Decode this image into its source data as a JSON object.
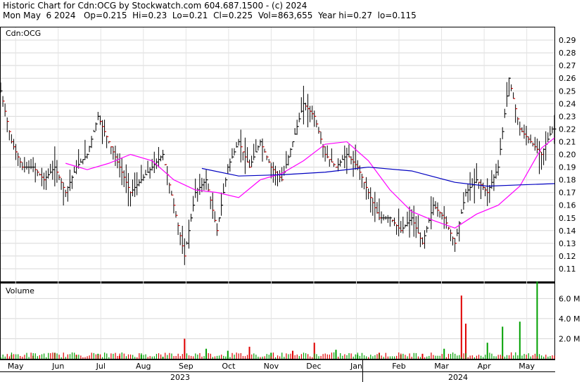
{
  "header": {
    "line1": "Historic Chart for Cdn:OCG by Stockwatch.com 604.687.1500 - (c) 2024",
    "line2": "Mon May  6 2024   Op=0.215  Hi=0.23  Lo=0.21  Cl=0.225  Vol=863,655  Year hi=0.27  lo=0.115"
  },
  "chart_data": [
    {
      "type": "ohlc",
      "title": "Cdn:OCG",
      "ylim": [
        0.1,
        0.3
      ],
      "yticks": [
        "0.11",
        "0.12",
        "0.13",
        "0.14",
        "0.15",
        "0.16",
        "0.17",
        "0.18",
        "0.19",
        "0.20",
        "0.21",
        "0.22",
        "0.23",
        "0.24",
        "0.25",
        "0.26",
        "0.27",
        "0.28",
        "0.29"
      ],
      "month_ticks": [
        "May",
        "Jun",
        "Jul",
        "Aug",
        "Sep",
        "Oct",
        "Nov",
        "Dec",
        "Jan",
        "Feb",
        "Mar",
        "Apr",
        "May"
      ],
      "year_labels": [
        "2023",
        "2024"
      ],
      "x_range": [
        0,
        256
      ],
      "series": [
        {
          "name": "",
          "kind": "price",
          "x": [
            0,
            5,
            10,
            15,
            20,
            25,
            30,
            35,
            40,
            45,
            50,
            55,
            60,
            65,
            70,
            75,
            80,
            85,
            90,
            95,
            100,
            105,
            110,
            115,
            120,
            125,
            130,
            135,
            140,
            145,
            150,
            155,
            160,
            165,
            170,
            175,
            180,
            185,
            190,
            195,
            200,
            205,
            210,
            215,
            220,
            225,
            230,
            235,
            240,
            245,
            250,
            255
          ],
          "values": [
            0.25,
            0.21,
            0.19,
            0.19,
            0.18,
            0.19,
            0.17,
            0.19,
            0.2,
            0.23,
            0.21,
            0.19,
            0.17,
            0.18,
            0.19,
            0.2,
            0.16,
            0.12,
            0.17,
            0.18,
            0.14,
            0.19,
            0.21,
            0.19,
            0.21,
            0.19,
            0.18,
            0.21,
            0.24,
            0.23,
            0.2,
            0.19,
            0.2,
            0.19,
            0.17,
            0.15,
            0.15,
            0.14,
            0.15,
            0.13,
            0.16,
            0.15,
            0.13,
            0.17,
            0.18,
            0.17,
            0.19,
            0.26,
            0.22,
            0.21,
            0.2,
            0.22
          ]
        },
        {
          "name": "",
          "kind": "moving-average-short",
          "color": "#ff00ff",
          "x": [
            30,
            40,
            50,
            60,
            70,
            80,
            90,
            100,
            110,
            120,
            130,
            140,
            150,
            160,
            170,
            180,
            190,
            200,
            210,
            220,
            230,
            240,
            250,
            256
          ],
          "values": [
            0.193,
            0.188,
            0.193,
            0.2,
            0.195,
            0.18,
            0.172,
            0.17,
            0.166,
            0.18,
            0.185,
            0.195,
            0.208,
            0.21,
            0.195,
            0.172,
            0.155,
            0.148,
            0.142,
            0.153,
            0.16,
            0.175,
            0.205,
            0.213
          ]
        },
        {
          "name": "",
          "kind": "moving-average-long",
          "color": "#0000c0",
          "x": [
            93,
            110,
            130,
            150,
            170,
            190,
            210,
            225,
            240,
            256
          ],
          "values": [
            0.189,
            0.183,
            0.184,
            0.186,
            0.19,
            0.187,
            0.178,
            0.175,
            0.176,
            0.177
          ]
        }
      ]
    },
    {
      "type": "bar",
      "title": "Volume",
      "ylim": [
        0,
        7.5
      ],
      "yticks": [
        "2.0 M",
        "4.0 M",
        "6.0 M"
      ],
      "x": [
        5,
        15,
        25,
        35,
        45,
        55,
        65,
        75,
        85,
        95,
        105,
        115,
        125,
        135,
        145,
        155,
        165,
        175,
        185,
        195,
        205,
        213,
        215,
        225,
        232,
        240,
        248
      ],
      "values": [
        0.4,
        0.3,
        0.6,
        0.4,
        0.5,
        0.3,
        0.4,
        0.2,
        2.0,
        1.0,
        0.8,
        1.2,
        0.6,
        0.8,
        1.6,
        0.9,
        0.4,
        0.6,
        0.4,
        0.5,
        1.0,
        6.3,
        3.5,
        1.6,
        3.2,
        3.7,
        7.7
      ],
      "colors": [
        "red",
        "red",
        "green",
        "red",
        "green",
        "red",
        "green",
        "green",
        "red",
        "green",
        "green",
        "red",
        "green",
        "red",
        "red",
        "green",
        "green",
        "red",
        "green",
        "red",
        "green",
        "red",
        "red",
        "green",
        "green",
        "green",
        "green"
      ]
    }
  ]
}
